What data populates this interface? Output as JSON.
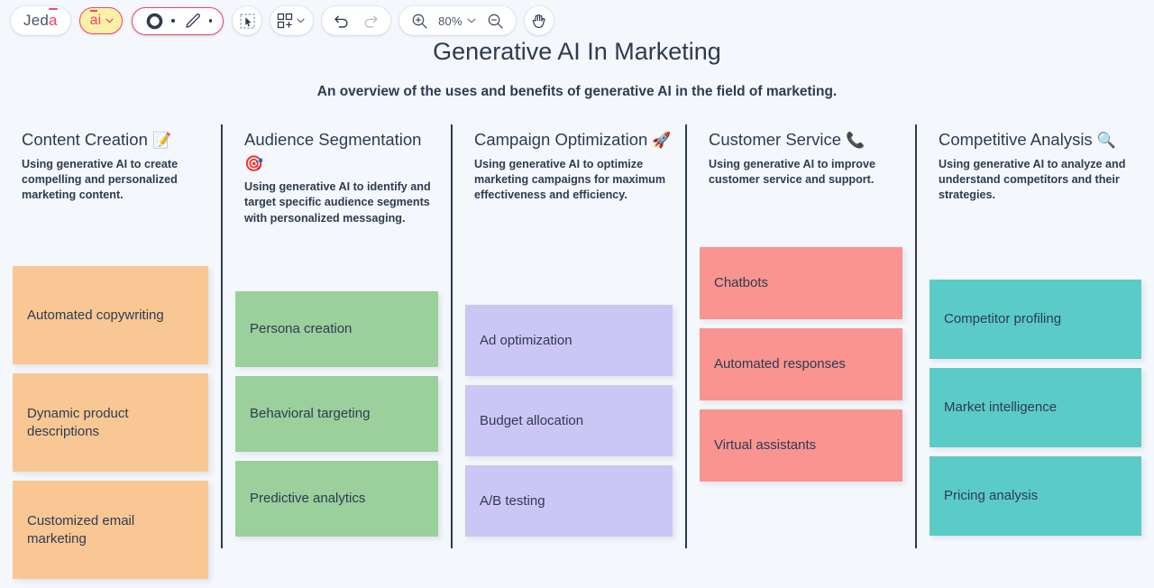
{
  "toolbar": {
    "logo": {
      "prefix": "Jed",
      "accent": "a"
    },
    "ai_button": {
      "label": "ai",
      "icon": "ai-sparkle-icon",
      "chevron": "chevron-down-icon"
    },
    "shape_tool": "circle-shape-icon",
    "pen_tool": "pencil-icon",
    "select_tool": "marquee-select-icon",
    "widgets_tool": "grid-add-icon",
    "undo": "undo-arrow-icon",
    "redo": "redo-arrow-icon",
    "zoom_in": "zoom-in-icon",
    "zoom_out": "zoom-out-icon",
    "zoom_level": "80%",
    "zoom_chevron": "chevron-down-icon",
    "pan_tool": "hand-icon"
  },
  "board": {
    "title": "Generative AI In Marketing",
    "subtitle": "An overview of the uses and benefits of generative AI in the field of marketing.",
    "colors": {
      "background": "#f4f7fb",
      "divider": "#2d3b52",
      "text": "#2d3b52",
      "accent_pink": "#f2456f",
      "ai_yellow": "#fbf0a8",
      "card_orange": "#f9c794",
      "card_green": "#9bcf9b",
      "card_purple": "#ccc6f5",
      "card_red": "#f99490",
      "card_teal": "#5bcbc7"
    },
    "columns": [
      {
        "title": "Content Creation",
        "emoji": "📝",
        "emoji_name": "memo-icon",
        "description": "Using generative AI to create compelling and personalized marketing content.",
        "card_color": "#f9c794",
        "cards": [
          "Automated copywriting",
          "Dynamic product descriptions",
          "Customized email marketing"
        ]
      },
      {
        "title": "Audience Segmentation",
        "emoji": "🎯",
        "emoji_name": "target-icon",
        "description": "Using generative AI to identify and target specific audience segments with personalized messaging.",
        "card_color": "#9bcf9b",
        "cards": [
          "Persona creation",
          "Behavioral targeting",
          "Predictive analytics"
        ]
      },
      {
        "title": "Campaign Optimization",
        "emoji": "🚀",
        "emoji_name": "rocket-icon",
        "description": "Using generative AI to optimize marketing campaigns for maximum effectiveness and efficiency.",
        "card_color": "#ccc6f5",
        "cards": [
          "Ad optimization",
          "Budget allocation",
          "A/B testing"
        ]
      },
      {
        "title": "Customer Service",
        "emoji": "📞",
        "emoji_name": "telephone-receiver-icon",
        "description": "Using generative AI to improve customer service and support.",
        "card_color": "#f99490",
        "cards": [
          "Chatbots",
          "Automated responses",
          "Virtual assistants"
        ]
      },
      {
        "title": "Competitive Analysis",
        "emoji": "🔍",
        "emoji_name": "magnifying-glass-icon",
        "description": "Using generative AI to analyze and understand competitors and their strategies.",
        "card_color": "#5bcbc7",
        "cards": [
          "Competitor profiling",
          "Market intelligence",
          "Pricing analysis"
        ]
      }
    ]
  }
}
